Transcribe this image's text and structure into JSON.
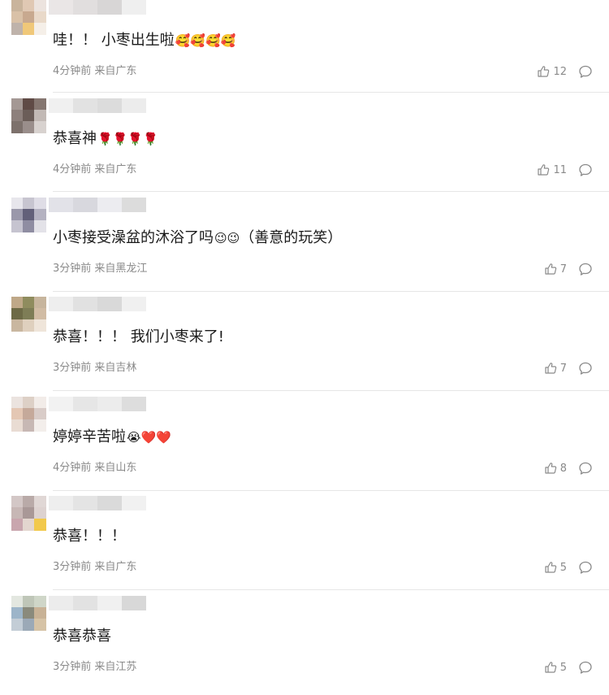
{
  "comments": [
    {
      "text": "哇！！ 小枣出生啦",
      "emojis": "🥰🥰🥰🥰",
      "time": "4分钟前",
      "location": "来自广东",
      "likes": "12",
      "avatar_colors": [
        "#c9b49c",
        "#e0c8b3",
        "#ece3de",
        "#d9c1a7",
        "#c8a98f",
        "#e9d9c9",
        "#bfb3ab",
        "#f0c879",
        "#f5efe8"
      ],
      "name_blur_colors": [
        "#eae6e6",
        "#e1dede",
        "#d8d6d6",
        "#efefef"
      ]
    },
    {
      "text": "恭喜神",
      "emojis": "🌹🌹🌹🌹",
      "time": "4分钟前",
      "location": "来自广东",
      "likes": "11",
      "avatar_colors": [
        "#a49894",
        "#5f4a45",
        "#857670",
        "#8d807c",
        "#6b5d58",
        "#c2b9b5",
        "#7d716c",
        "#9a8e8b",
        "#d8d2cf"
      ],
      "name_blur_colors": [
        "#f0f0f0",
        "#e2e2e2",
        "#dcdcdc",
        "#ececec"
      ]
    },
    {
      "text": "小枣接受澡盆的沐浴了吗",
      "emojis": "😉😉",
      "suffix": "（善意的玩笑）",
      "time": "3分钟前",
      "location": "来自黑龙江",
      "likes": "7",
      "avatar_colors": [
        "#e7e6ec",
        "#c7c5d0",
        "#dfdde6",
        "#9a98aa",
        "#626079",
        "#b4b2c1",
        "#c6c4d0",
        "#8f8da2",
        "#e3e2e8"
      ],
      "name_blur_colors": [
        "#e2e2e8",
        "#d8d8de",
        "#ececf0",
        "#dcdcdc"
      ]
    },
    {
      "text": "恭喜！！！ 我们小枣来了!",
      "time": "3分钟前",
      "location": "来自吉林",
      "likes": "7",
      "avatar_colors": [
        "#bfa888",
        "#8f8c5e",
        "#c7b59d",
        "#6d6a46",
        "#7e7d56",
        "#d1bca4",
        "#c9b7a0",
        "#dfd0be",
        "#efe5da"
      ],
      "name_blur_colors": [
        "#eeeeee",
        "#e1e1e1",
        "#d9d9d9",
        "#f0f0f0"
      ]
    },
    {
      "text": "婷婷辛苦啦",
      "emojis": "😭❤️❤️",
      "time": "4分钟前",
      "location": "来自山东",
      "likes": "8",
      "avatar_colors": [
        "#ebe3df",
        "#ddd0c6",
        "#f2ece8",
        "#e4c7b4",
        "#c5a99a",
        "#d9ccc8",
        "#e9dcd3",
        "#c7b8b4",
        "#f3eeeb"
      ],
      "name_blur_colors": [
        "#f2f2f2",
        "#e6e6e6",
        "#ececec",
        "#dddddd"
      ]
    },
    {
      "text": "恭喜！！！",
      "time": "3分钟前",
      "location": "来自广东",
      "likes": "5",
      "avatar_colors": [
        "#d3c7c6",
        "#b9aaa8",
        "#e0d7d5",
        "#c7b7b5",
        "#a99897",
        "#ddd2d0",
        "#c9a6ae",
        "#e3d6cf",
        "#f2c94c"
      ],
      "name_blur_colors": [
        "#eeeeee",
        "#e4e4e4",
        "#dadada",
        "#f1f1f1"
      ]
    },
    {
      "text": "恭喜恭喜",
      "time": "3分钟前",
      "location": "来自江苏",
      "likes": "5",
      "avatar_colors": [
        "#e3e7e0",
        "#bfc6b8",
        "#cfd6c8",
        "#9db5c9",
        "#8a8a7c",
        "#c8b296",
        "#c3cdd6",
        "#9ba9b7",
        "#d6c3a6"
      ],
      "name_blur_colors": [
        "#ececec",
        "#e2e2e2",
        "#f0f0f0",
        "#d8d8d8"
      ]
    }
  ],
  "icons": {
    "like": "thumbs-up-icon",
    "reply": "comment-icon"
  },
  "colors": {
    "text": "#1a1a1a",
    "meta": "#8a8a8a",
    "divider": "#e6e6e6"
  }
}
